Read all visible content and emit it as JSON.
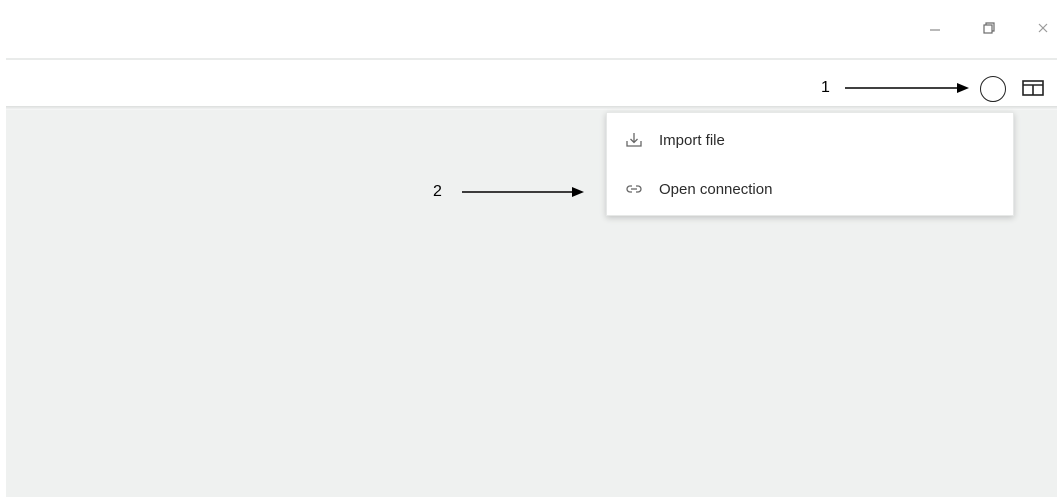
{
  "window": {
    "minimize_icon": "minimize-icon",
    "restore_icon": "restore-icon",
    "close_icon": "close-icon"
  },
  "toolbar": {
    "add_button_icon": "circle-button",
    "panel_toggle_icon": "panel-layout-icon"
  },
  "menu": {
    "items": [
      {
        "label": "Import file",
        "icon": "download-icon"
      },
      {
        "label": "Open connection",
        "icon": "link-icon"
      }
    ]
  },
  "annotations": {
    "marker_1": "1",
    "marker_2": "2"
  },
  "colors": {
    "content_background": "#eff1f0",
    "menu_background": "#ffffff",
    "text": "#2b2b2b"
  }
}
